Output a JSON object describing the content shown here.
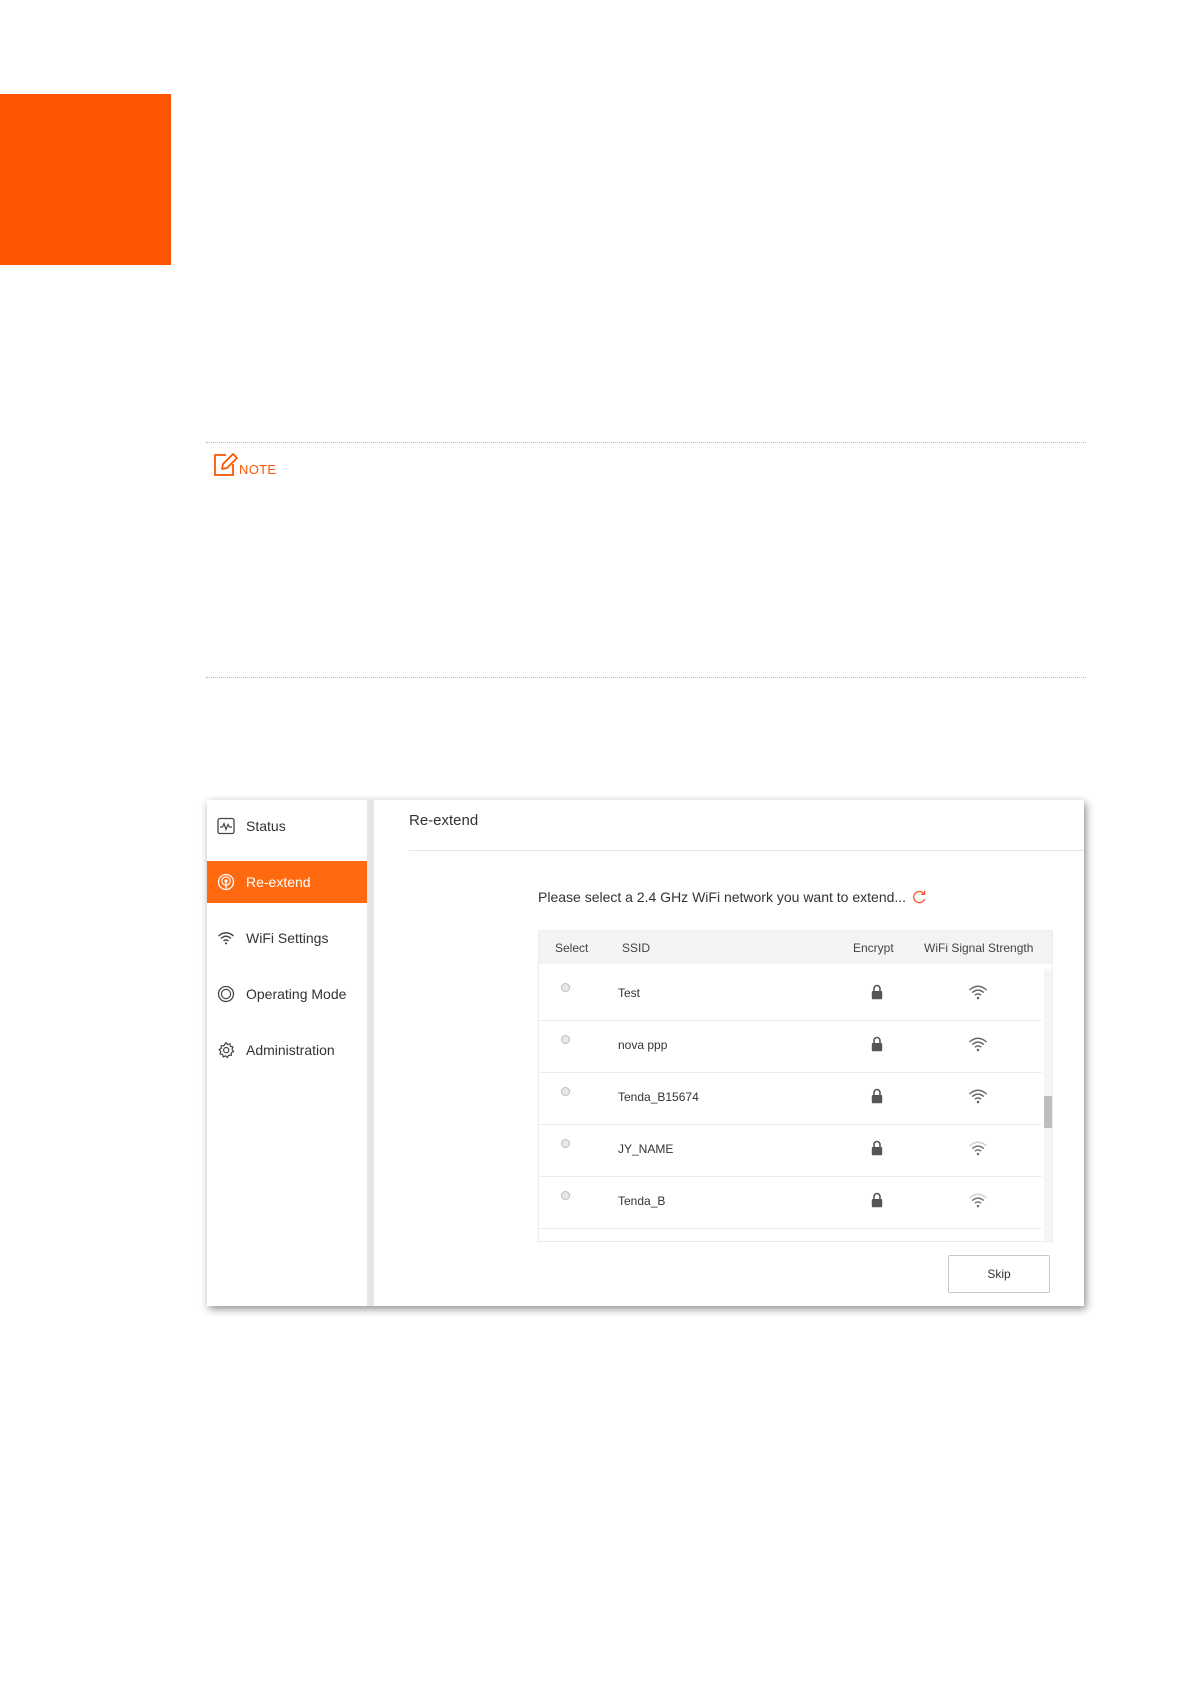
{
  "note": {
    "label": "NOTE"
  },
  "sidebar": {
    "items": [
      {
        "label": "Status",
        "icon": "status-icon",
        "active": false
      },
      {
        "label": "Re-extend",
        "icon": "re-extend-icon",
        "active": true
      },
      {
        "label": "WiFi Settings",
        "icon": "wifi-icon",
        "active": false
      },
      {
        "label": "Operating Mode",
        "icon": "operating-mode-icon",
        "active": false
      },
      {
        "label": "Administration",
        "icon": "gear-icon",
        "active": false
      }
    ]
  },
  "main": {
    "title": "Re-extend",
    "prompt": "Please select a 2.4 GHz WiFi network you want to extend...",
    "table": {
      "headers": [
        "Select",
        "SSID",
        "Encrypt",
        "WiFi Signal Strength"
      ],
      "rows": [
        {
          "ssid": "Test",
          "encrypted": true,
          "signal_bars": 4
        },
        {
          "ssid": "nova ppp",
          "encrypted": true,
          "signal_bars": 4
        },
        {
          "ssid": "Tenda_B15674",
          "encrypted": true,
          "signal_bars": 4
        },
        {
          "ssid": "JY_NAME",
          "encrypted": true,
          "signal_bars": 3
        },
        {
          "ssid": "Tenda_B",
          "encrypted": true,
          "signal_bars": 3
        }
      ]
    },
    "skip_label": "Skip"
  },
  "colors": {
    "accent": "#ff5500",
    "active_nav": "#ff6a10"
  }
}
